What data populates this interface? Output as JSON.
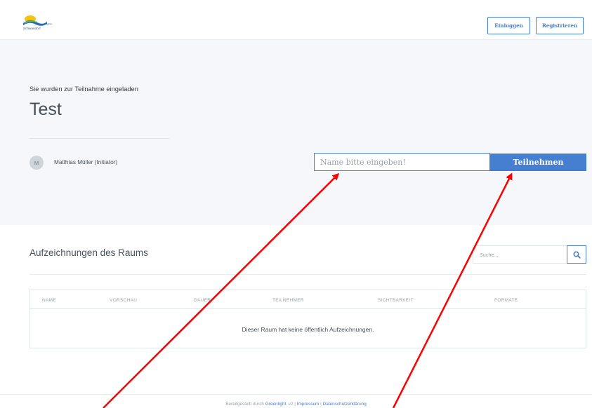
{
  "header": {
    "logo": {
      "name": "Schwandorf",
      "sub": "Landkreis"
    },
    "login_label": "Einloggen",
    "register_label": "Registrieren"
  },
  "room": {
    "invited_text": "Sie wurden zur Teilnahme eingeladen",
    "title": "Test",
    "owner_initial": "M",
    "owner_name": "Matthias Müller (Initiator)",
    "name_placeholder": "Name bitte eingeben!",
    "join_label": "Teilnehmen"
  },
  "recordings": {
    "title": "Aufzeichnungen des Raums",
    "search_placeholder": "Suche...",
    "search_icon": "search-icon",
    "columns": [
      "NAME",
      "VORSCHAU",
      "DAUER",
      "TEILNEHMER",
      "SICHTBARKEIT",
      "FORMATE"
    ],
    "empty_message": "Dieser Raum hat keine öffentlich Aufzeichnungen."
  },
  "footer": {
    "prefix": "Bereitgestellt durch ",
    "greenlight_link": "Greenlight",
    "version": ". v2 | ",
    "impressum_link": "Impressum",
    "separator": " | ",
    "privacy_link": "Datenschutzerklärung"
  },
  "colors": {
    "accent": "#467fcf",
    "hero_bg": "#f5f7fb",
    "annotation_arrow": "#ff0000"
  }
}
